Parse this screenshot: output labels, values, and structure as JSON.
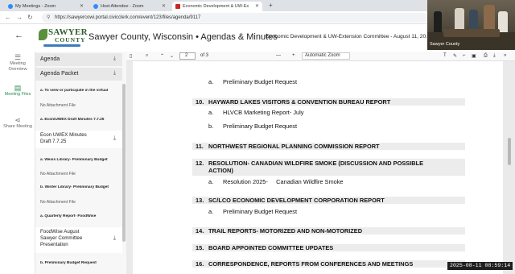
{
  "browser": {
    "tabs": [
      {
        "title": "My Meetings - Zoom"
      },
      {
        "title": "Host Attendee - Zoom"
      },
      {
        "title": "Economic Development & UW-Ex"
      }
    ],
    "url": "https://sawyercowi.portal.civicclerk.com/event/123/files/agenda/9117"
  },
  "header": {
    "logo_top": "SAWYER",
    "logo_bottom": "COUNTY",
    "site_title": "Sawyer County, Wisconsin • Agendas & Minutes",
    "meeting_name": "Economic Development & UW-Extension Committee - August 11, 2025"
  },
  "camera": {
    "label": "Sawyer County"
  },
  "rail": [
    {
      "label": "Meeting Overview",
      "icon": "list-icon"
    },
    {
      "label": "Meeting Files",
      "icon": "file-icon",
      "active": true
    },
    {
      "label": "Share Meeting",
      "icon": "share-icon"
    }
  ],
  "files": {
    "agenda": "Agenda",
    "packet": "Agenda Packet",
    "items": [
      {
        "text": "a. To view or participate in the virtual",
        "kind": "bold"
      },
      {
        "text": "No Attachment File",
        "kind": "na"
      },
      {
        "text": "a. Econ/UWEX Draft Minutes 7.7.25",
        "kind": "bold"
      },
      {
        "text": "Econ UWEX Minutes Draft 7.7.25",
        "kind": "doc"
      },
      {
        "text": "a. Weiss Library- Preliminary Budget",
        "kind": "bold"
      },
      {
        "text": "No Attachment File",
        "kind": "na"
      },
      {
        "text": "b. Winter Library- Preliminary Budget",
        "kind": "bold"
      },
      {
        "text": "No Attachment File",
        "kind": "na"
      },
      {
        "text": "a. Quarterly Report- FoodWise",
        "kind": "bold"
      },
      {
        "text": "FoodWise August Sawyer Committee Presentation",
        "kind": "doc"
      },
      {
        "text": "b. Preliminary Budget Request",
        "kind": "bold"
      }
    ]
  },
  "pdf": {
    "page": "2",
    "of": "of 3",
    "zoom": "Automatic Zoom",
    "lines": [
      {
        "type": "item",
        "letter": "a.",
        "text": "Preliminary Budget Request"
      },
      {
        "type": "section",
        "num": "10.",
        "text": "HAYWARD LAKES VISITORS & CONVENTION BUREAU REPORT"
      },
      {
        "type": "item",
        "letter": "a.",
        "text": "HLVCB Marketing Report- July"
      },
      {
        "type": "item",
        "letter": "b.",
        "text": "Preliminary Budget Request"
      },
      {
        "type": "section",
        "num": "11.",
        "text": "NORTHWEST REGIONAL PLANNING COMMISSION REPORT"
      },
      {
        "type": "section2",
        "num": "12.",
        "text": "RESOLUTION- CANADIAN WILDFIRE SMOKE (DISCUSSION AND POSSIBLE",
        "text2": "ACTION)"
      },
      {
        "type": "item",
        "letter": "a.",
        "text": "Resolution 2025-     Canadian Wildfire Smoke"
      },
      {
        "type": "section",
        "num": "13.",
        "text": "SC/LCO ECONOMIC DEVELOPMENT CORPORATION REPORT"
      },
      {
        "type": "item",
        "letter": "a.",
        "text": "Preliminary Budget Request"
      },
      {
        "type": "section",
        "num": "14.",
        "text": "TRAIL REPORTS- MOTORIZED AND NON-MOTORIZED"
      },
      {
        "type": "section",
        "num": "15.",
        "text": "BOARD APPOINTED COMMITTEE UPDATES"
      },
      {
        "type": "section",
        "num": "16.",
        "text": "CORRESPONDENCE, REPORTS FROM CONFERENCES AND MEETINGS"
      }
    ]
  },
  "timestamp": "2025-08-11  08:59:14"
}
